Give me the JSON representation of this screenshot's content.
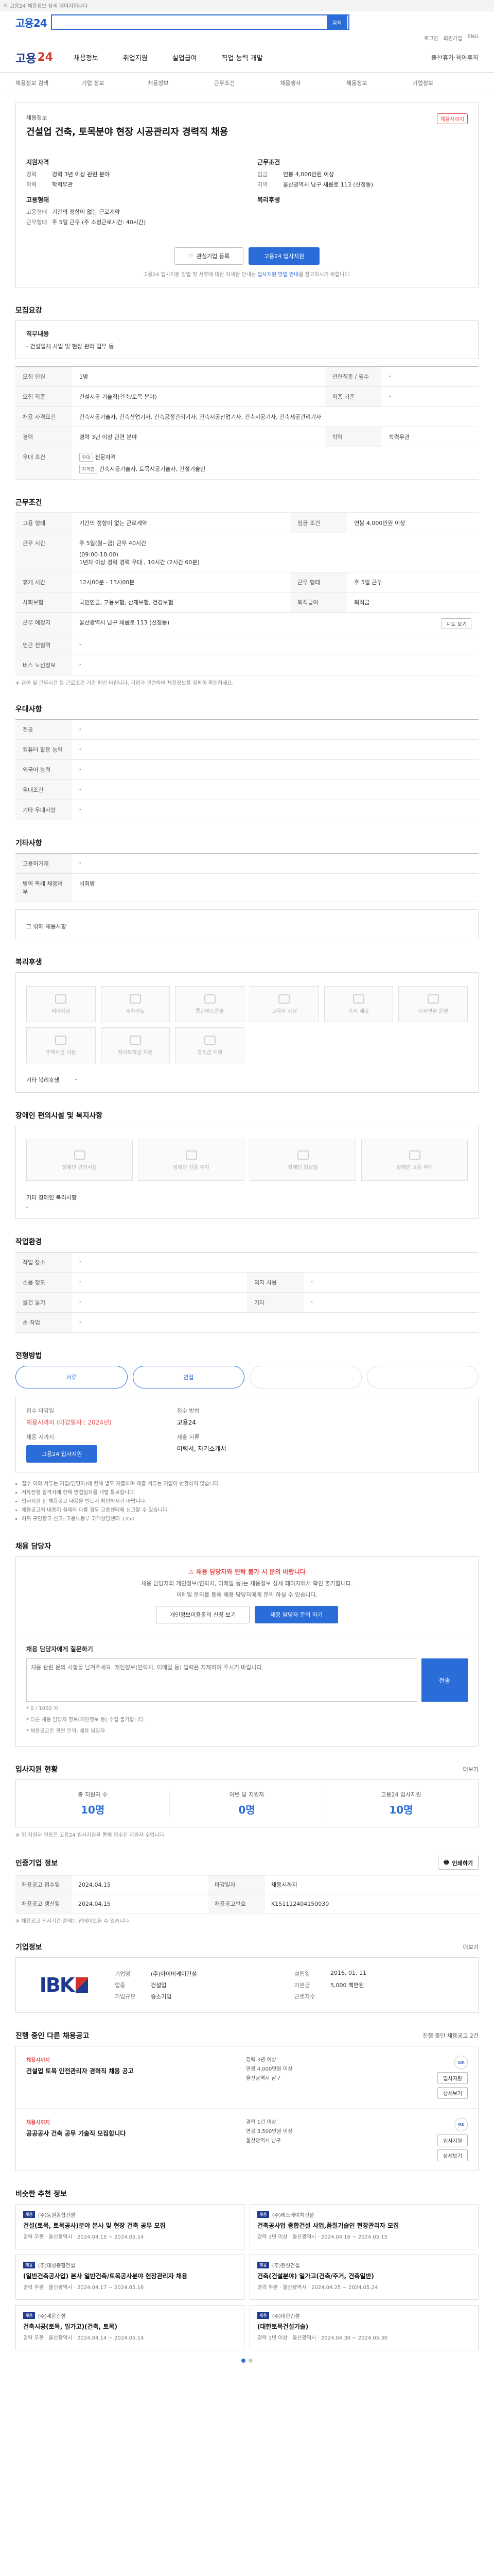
{
  "topbar": {
    "text": "고용24 채용정보 상세 페이지입니다"
  },
  "search": {
    "logo": "고용24",
    "placeholder": "",
    "button": "검색"
  },
  "header_links": [
    "로그인",
    "회원가입",
    "ENG"
  ],
  "gnb": {
    "brand_a": "고용",
    "brand_b": "24",
    "menu": [
      "채용정보",
      "취업지원",
      "실업급여",
      "직업 능력 개발"
    ],
    "side": "출산휴가·육아휴직"
  },
  "crumbs": [
    "채용정보 검색",
    "기업 정보",
    "채용정보",
    "근무조건",
    "채용행사",
    "채용정보",
    "기업정보"
  ],
  "job": {
    "category": "채용정보",
    "title": "건설업 건축, 토목분야 현장 시공관리자 경력직 채용",
    "tag": "채용시까지",
    "left_title": "지원자격",
    "left": [
      {
        "k": "경력",
        "v": "경력 3년 이상 관련 분야"
      },
      {
        "k": "학력",
        "v": "학력무관"
      }
    ],
    "left_title2": "고용형태",
    "left2": [
      {
        "k": "고용형태",
        "v": "기간의 정함이 없는 근로계약"
      },
      {
        "k": "근무형태",
        "v": "주 5일 근무 (주 소정근로시간: 40시간)"
      }
    ],
    "right_title": "근무조건",
    "right": [
      {
        "k": "임금",
        "v": "연봉 4,000만원 이상"
      },
      {
        "k": "지역",
        "v": "울산광역시 남구 새릅로 113 (신정동)"
      }
    ],
    "right_title2": "복리후생",
    "btn_interest": "관심기업 등록",
    "btn_apply": "고용24 입사지원",
    "notice_a": "고용24 입사지원 방법 및 서류에 대한 자세한 안내는",
    "notice_b": "입사지원 방법 안내",
    "notice_c": "를 참고하시기 바랍니다."
  },
  "duty": {
    "title": "모집요강",
    "label": "직무내용",
    "text": "- 건설업체 사업 및 현장 관리 업무 등"
  },
  "recruit_table": {
    "rows": [
      {
        "k": "모집 인원",
        "v": "1명",
        "k2": "관련직종 / 필수",
        "v2": "-"
      },
      {
        "k": "모집 직종",
        "v": "건설시공 기술직(건축/토목 분야)",
        "k2": "직종 기준",
        "v2": "-"
      },
      {
        "k": "채용 자격요건",
        "v": "건축시공기술자, 건축산업기사, 건축공정관리기사, 건축시공산업기사, 건축시공기사, 건축제공관리기사",
        "k2": "",
        "v2": ""
      },
      {
        "k": "경력",
        "v": "경력 3년 이상 관련 분야",
        "k2": "학력",
        "v2": "학력무관"
      }
    ],
    "prefer_label": "우대 조건",
    "prefer_chips": [
      "우대",
      "자격증"
    ],
    "prefer_items": [
      "전문자격",
      "건축시공기술자, 토목시공기술자, 건설기술인"
    ]
  },
  "conditions": {
    "title": "근무조건",
    "rows": [
      {
        "k": "고용 형태",
        "v": "기간의 정함이 없는 근로계약",
        "k2": "임금 조건",
        "v2": "연봉 4,000만원 이상"
      },
      {
        "k": "근무 시간",
        "v": "주 5일(월~금) 근무 40시간",
        "k2": "",
        "v2": ""
      }
    ],
    "time_lines": [
      "(09:00-18:00)",
      "1년차 이상 경력 경력 우대 , 10시간 (2시간 60분)"
    ],
    "more_rows": [
      {
        "k": "휴게 시간",
        "v": "12시00분 - 13시00분",
        "k2": "근무 형태",
        "v2": "주 5일 근무"
      },
      {
        "k": "사회보험",
        "v": "국민연금, 고용보험, 산재보험, 건강보험",
        "k2": "퇴직급여",
        "v2": "퇴직금"
      },
      {
        "k": "근무 예정지",
        "v": "울산광역시 남구 새릅로 113 (신정동)",
        "k2": "",
        "v2": ""
      },
      {
        "k": "인근 전철역",
        "v": "-",
        "k2": "",
        "v2": ""
      },
      {
        "k": "버스 노선정보",
        "v": "-",
        "k2": "",
        "v2": ""
      }
    ],
    "map_btn": "지도 보기",
    "note": "※ 급여 및 근무시간 등 근로조건 기준 확인 바랍니다. 기업과 관련하여 채용정보를 정확히 확인하세요."
  },
  "prefer2": {
    "title": "우대사항",
    "rows": [
      {
        "k": "전공",
        "v": "-"
      },
      {
        "k": "컴퓨터 활용 능력",
        "v": "-"
      },
      {
        "k": "외국어 능력",
        "v": "-"
      },
      {
        "k": "우대조건",
        "v": "-"
      },
      {
        "k": "기타 우대사항",
        "v": "-"
      }
    ]
  },
  "etc": {
    "title": "기타사항",
    "rows": [
      {
        "k": "고용허가제",
        "v": "-"
      },
      {
        "k": "병역 특례 채용여부",
        "v": "비희망"
      }
    ],
    "extra_label": "그 밖에 채용사항"
  },
  "welfare": {
    "title": "복리후생",
    "items": [
      "식대지원",
      "주차가능",
      "통근버스운영",
      "교육비 지원",
      "숙식 제공",
      "퇴직연금 운영",
      "주택자금 지원",
      "자녀학자금 지원",
      "경조금 지원"
    ],
    "etc_label": "기타 복리후생",
    "etc_value": "-"
  },
  "disability": {
    "title": "장애인 편의시설 및 복지사항",
    "items": [
      "장애인 편의시설",
      "장애인 전용 주차",
      "장애인 화장실",
      "장애인 고용 우대"
    ],
    "etc_label": "기타 장애인 복리사항",
    "etc_value": "-"
  },
  "workplace": {
    "title": "작업환경",
    "rows": [
      {
        "k": "작업 장소",
        "v": "-",
        "k2": "",
        "v2": ""
      },
      {
        "k": "소음 정도",
        "v": "-",
        "k2": "의자 사용",
        "v2": "-"
      },
      {
        "k": "물건 들기",
        "v": "-",
        "k2": "기타",
        "v2": "-"
      },
      {
        "k": "손 작업",
        "v": "-",
        "k2": "",
        "v2": ""
      }
    ]
  },
  "process": {
    "title": "전형방법",
    "steps": [
      "서류",
      "면접",
      "",
      ""
    ],
    "apply_k1": "접수 마감일",
    "apply_v1_a": "채용시까지 (마감일자 : 2024",
    "apply_v1_b": "년)",
    "apply_k2": "접수 방법",
    "apply_v2": "고용24",
    "apply_k3": "제출 서류",
    "apply_v3": "이력서, 자기소개서",
    "apply_k4": "채용 시까지",
    "apply_v4": "",
    "apply_btn": "고용24 입사지원",
    "bullets": [
      "접수 이외 서류는 기업(담당자)에 한해 별도 제출하며 제출 서류는 기업이 반환하지 않습니다.",
      "서류전형 합격자에 한해 면접일자를 개별 통보합니다.",
      "입사지원 전 채용공고 내용을 반드시 확인하시기 바랍니다.",
      "채용공고의 내용이 실제와 다를 경우 고용센터에 신고할 수 있습니다.",
      "허위 구인광고 신고: 고용노동부 고객상담센터 1350"
    ]
  },
  "qna": {
    "title": "채용 담당자",
    "alert": "채용 담당자와 연락 불가 시 문의 바랍니다",
    "p1": "채용 담당자의 개인정보(연락처, 이메일 등)는 채용정보 상세 페이지에서 확인 불가합니다.",
    "p2": "이메일 문의를 통해 채용 담당자에게 문의 하실 수 있습니다.",
    "btn1": "개인정보이용동의 신청 보기",
    "btn2": "채용 담당자 문의 하기",
    "form_label": "채용 담당자에게 질문하기",
    "placeholder": "채용 관련 문의 사항을 남겨주세요. 개인정보(연락처, 이메일 등) 입력은 자제하여 주시기 바랍니다.",
    "send": "전송",
    "hint1": "* 0 / 1000 자",
    "hint2": "* 다른 채용 담당자 정보(개인정보 등) 수집 불가합니다.",
    "hint3": "* 채용공고문 관련 문의: 채용 담당자"
  },
  "stats": {
    "title": "입사지원 현황",
    "more": "더보기",
    "items": [
      {
        "k": "총 지원자 수",
        "v": "10명"
      },
      {
        "k": "이번 달 지원자",
        "v": "0명"
      },
      {
        "k": "고용24 입사지원",
        "v": "10명"
      }
    ],
    "note": "※ 위 지원자 현황은 고용24 입사지원을 통해 접수된 지원자 수입니다."
  },
  "job_info": {
    "title": "인증기업 정보",
    "btn": "인쇄하기",
    "rows": [
      {
        "k": "채용공고 접수일",
        "v": "2024.04.15",
        "k2": "마감일자",
        "v2": "채용시까지"
      },
      {
        "k": "채용공고 갱신일",
        "v": "2024.04.15",
        "k2": "채용공고번호",
        "v2": "K151112404150030"
      }
    ],
    "note": "※ 채용공고 게시기간 중에는 업데이트될 수 있습니다."
  },
  "company": {
    "title": "기업정보",
    "more": "더보기",
    "logo_text": "IBK",
    "rows": [
      {
        "k": "기업명",
        "v": "(주)아이비케이건설",
        "k2": "설립일",
        "v2": "2016. 01. 11"
      },
      {
        "k": "업종",
        "v": "건설업",
        "k2": "자본금",
        "v2": "5,000 백만원"
      },
      {
        "k": "기업규모",
        "v": "중소기업",
        "k2": "근로자수",
        "v2": ""
      }
    ]
  },
  "other_jobs": {
    "title": "진행 중인 다른 채용공고",
    "more": "진행 중인 채용공고 2건",
    "items": [
      {
        "co": "채용시까지",
        "t": "건설업 토목 안전관리자 경력직 채용 공고",
        "meta": [
          "경력 3년 이상",
          "연봉 4,000만원 이상",
          "울산광역시 남구"
        ],
        "btn1": "입사지원",
        "btn2": "상세보기"
      },
      {
        "co": "채용시까지",
        "t": "공공공사 건축 공무 기술직 모집합니다",
        "meta": [
          "경력 1년 이상",
          "연봉 3,500만원 이상",
          "울산광역시 남구"
        ],
        "btn1": "입사지원",
        "btn2": "상세보기"
      }
    ]
  },
  "recommend": {
    "title": "비슷한 추천 정보",
    "items": [
      {
        "co": "(주)동원종합건설",
        "t": "건설(토목, 토목공사)분야 본사 및 현장 건축 공무 모집",
        "m": "경력 무관 · 울산광역시 · 2024.04.15 ~ 2024.05.14"
      },
      {
        "co": "(주)에스에이치건설",
        "t": "건축공사업 종합건설 사업,품질기술인 현장관리자 모집",
        "m": "경력 3년 이상 · 울산광역시 · 2024.04.16 ~ 2024.05.15"
      },
      {
        "co": "(주)대성종합건설",
        "t": "(일반건축공사업) 본사 일반건축/토목공사분야 현장관리자 채용",
        "m": "경력 무관 · 울산광역시 · 2024.04.17 ~ 2024.05.16"
      },
      {
        "co": "(주)한신건설",
        "t": "건축(건설분야) 일가고(건축/주거, 건축일반)",
        "m": "경력 무관 · 울산광역시 · 2024.04.25 ~ 2024.05.24"
      },
      {
        "co": "(주)세운건설",
        "t": "건축시공(토목, 일가고)(건축, 토목)",
        "m": "경력 무관 · 울산광역시 · 2024.04.14 ~ 2024.05.14"
      },
      {
        "co": "(주)대한건설",
        "t": "(대한토목건설기술)",
        "m": "경력 1년 이상 · 울산광역시 · 2024.04.30 ~ 2024.05.30"
      }
    ]
  }
}
